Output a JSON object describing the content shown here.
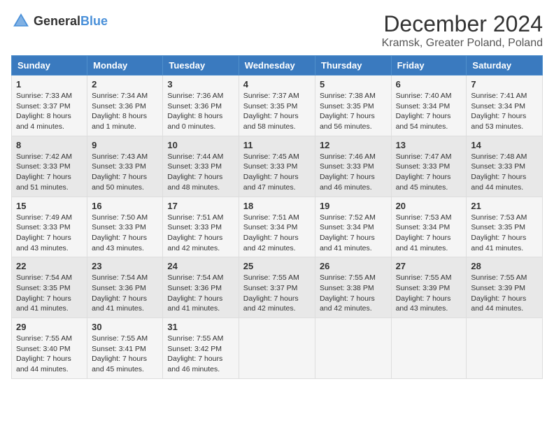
{
  "header": {
    "logo_general": "General",
    "logo_blue": "Blue",
    "title": "December 2024",
    "subtitle": "Kramsk, Greater Poland, Poland"
  },
  "columns": [
    "Sunday",
    "Monday",
    "Tuesday",
    "Wednesday",
    "Thursday",
    "Friday",
    "Saturday"
  ],
  "weeks": [
    [
      {
        "day": "1",
        "sunrise": "Sunrise: 7:33 AM",
        "sunset": "Sunset: 3:37 PM",
        "daylight": "Daylight: 8 hours and 4 minutes."
      },
      {
        "day": "2",
        "sunrise": "Sunrise: 7:34 AM",
        "sunset": "Sunset: 3:36 PM",
        "daylight": "Daylight: 8 hours and 1 minute."
      },
      {
        "day": "3",
        "sunrise": "Sunrise: 7:36 AM",
        "sunset": "Sunset: 3:36 PM",
        "daylight": "Daylight: 8 hours and 0 minutes."
      },
      {
        "day": "4",
        "sunrise": "Sunrise: 7:37 AM",
        "sunset": "Sunset: 3:35 PM",
        "daylight": "Daylight: 7 hours and 58 minutes."
      },
      {
        "day": "5",
        "sunrise": "Sunrise: 7:38 AM",
        "sunset": "Sunset: 3:35 PM",
        "daylight": "Daylight: 7 hours and 56 minutes."
      },
      {
        "day": "6",
        "sunrise": "Sunrise: 7:40 AM",
        "sunset": "Sunset: 3:34 PM",
        "daylight": "Daylight: 7 hours and 54 minutes."
      },
      {
        "day": "7",
        "sunrise": "Sunrise: 7:41 AM",
        "sunset": "Sunset: 3:34 PM",
        "daylight": "Daylight: 7 hours and 53 minutes."
      }
    ],
    [
      {
        "day": "8",
        "sunrise": "Sunrise: 7:42 AM",
        "sunset": "Sunset: 3:33 PM",
        "daylight": "Daylight: 7 hours and 51 minutes."
      },
      {
        "day": "9",
        "sunrise": "Sunrise: 7:43 AM",
        "sunset": "Sunset: 3:33 PM",
        "daylight": "Daylight: 7 hours and 50 minutes."
      },
      {
        "day": "10",
        "sunrise": "Sunrise: 7:44 AM",
        "sunset": "Sunset: 3:33 PM",
        "daylight": "Daylight: 7 hours and 48 minutes."
      },
      {
        "day": "11",
        "sunrise": "Sunrise: 7:45 AM",
        "sunset": "Sunset: 3:33 PM",
        "daylight": "Daylight: 7 hours and 47 minutes."
      },
      {
        "day": "12",
        "sunrise": "Sunrise: 7:46 AM",
        "sunset": "Sunset: 3:33 PM",
        "daylight": "Daylight: 7 hours and 46 minutes."
      },
      {
        "day": "13",
        "sunrise": "Sunrise: 7:47 AM",
        "sunset": "Sunset: 3:33 PM",
        "daylight": "Daylight: 7 hours and 45 minutes."
      },
      {
        "day": "14",
        "sunrise": "Sunrise: 7:48 AM",
        "sunset": "Sunset: 3:33 PM",
        "daylight": "Daylight: 7 hours and 44 minutes."
      }
    ],
    [
      {
        "day": "15",
        "sunrise": "Sunrise: 7:49 AM",
        "sunset": "Sunset: 3:33 PM",
        "daylight": "Daylight: 7 hours and 43 minutes."
      },
      {
        "day": "16",
        "sunrise": "Sunrise: 7:50 AM",
        "sunset": "Sunset: 3:33 PM",
        "daylight": "Daylight: 7 hours and 43 minutes."
      },
      {
        "day": "17",
        "sunrise": "Sunrise: 7:51 AM",
        "sunset": "Sunset: 3:33 PM",
        "daylight": "Daylight: 7 hours and 42 minutes."
      },
      {
        "day": "18",
        "sunrise": "Sunrise: 7:51 AM",
        "sunset": "Sunset: 3:34 PM",
        "daylight": "Daylight: 7 hours and 42 minutes."
      },
      {
        "day": "19",
        "sunrise": "Sunrise: 7:52 AM",
        "sunset": "Sunset: 3:34 PM",
        "daylight": "Daylight: 7 hours and 41 minutes."
      },
      {
        "day": "20",
        "sunrise": "Sunrise: 7:53 AM",
        "sunset": "Sunset: 3:34 PM",
        "daylight": "Daylight: 7 hours and 41 minutes."
      },
      {
        "day": "21",
        "sunrise": "Sunrise: 7:53 AM",
        "sunset": "Sunset: 3:35 PM",
        "daylight": "Daylight: 7 hours and 41 minutes."
      }
    ],
    [
      {
        "day": "22",
        "sunrise": "Sunrise: 7:54 AM",
        "sunset": "Sunset: 3:35 PM",
        "daylight": "Daylight: 7 hours and 41 minutes."
      },
      {
        "day": "23",
        "sunrise": "Sunrise: 7:54 AM",
        "sunset": "Sunset: 3:36 PM",
        "daylight": "Daylight: 7 hours and 41 minutes."
      },
      {
        "day": "24",
        "sunrise": "Sunrise: 7:54 AM",
        "sunset": "Sunset: 3:36 PM",
        "daylight": "Daylight: 7 hours and 41 minutes."
      },
      {
        "day": "25",
        "sunrise": "Sunrise: 7:55 AM",
        "sunset": "Sunset: 3:37 PM",
        "daylight": "Daylight: 7 hours and 42 minutes."
      },
      {
        "day": "26",
        "sunrise": "Sunrise: 7:55 AM",
        "sunset": "Sunset: 3:38 PM",
        "daylight": "Daylight: 7 hours and 42 minutes."
      },
      {
        "day": "27",
        "sunrise": "Sunrise: 7:55 AM",
        "sunset": "Sunset: 3:39 PM",
        "daylight": "Daylight: 7 hours and 43 minutes."
      },
      {
        "day": "28",
        "sunrise": "Sunrise: 7:55 AM",
        "sunset": "Sunset: 3:39 PM",
        "daylight": "Daylight: 7 hours and 44 minutes."
      }
    ],
    [
      {
        "day": "29",
        "sunrise": "Sunrise: 7:55 AM",
        "sunset": "Sunset: 3:40 PM",
        "daylight": "Daylight: 7 hours and 44 minutes."
      },
      {
        "day": "30",
        "sunrise": "Sunrise: 7:55 AM",
        "sunset": "Sunset: 3:41 PM",
        "daylight": "Daylight: 7 hours and 45 minutes."
      },
      {
        "day": "31",
        "sunrise": "Sunrise: 7:55 AM",
        "sunset": "Sunset: 3:42 PM",
        "daylight": "Daylight: 7 hours and 46 minutes."
      },
      null,
      null,
      null,
      null
    ]
  ]
}
